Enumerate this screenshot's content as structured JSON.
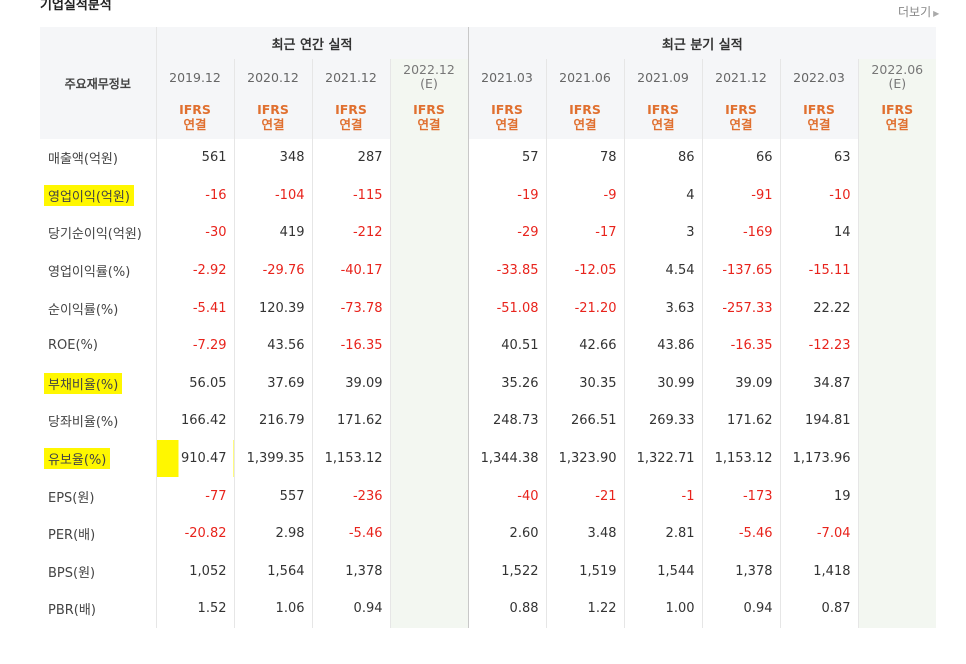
{
  "title": "기업실적분석",
  "more": "더보기",
  "row_header": "주요재무정보",
  "groups": {
    "annual": "최근 연간 실적",
    "quarterly": "최근 분기 실적"
  },
  "periods": [
    {
      "label": "2019.12",
      "sub": ""
    },
    {
      "label": "2020.12",
      "sub": ""
    },
    {
      "label": "2021.12",
      "sub": ""
    },
    {
      "label": "2022.12",
      "sub": "(E)"
    },
    {
      "label": "2021.03",
      "sub": ""
    },
    {
      "label": "2021.06",
      "sub": ""
    },
    {
      "label": "2021.09",
      "sub": ""
    },
    {
      "label": "2021.12",
      "sub": ""
    },
    {
      "label": "2022.03",
      "sub": ""
    },
    {
      "label": "2022.06",
      "sub": "(E)"
    }
  ],
  "ifrs": {
    "top": "IFRS",
    "bottom": "연결"
  },
  "rows": [
    {
      "label": "매출액(억원)",
      "highlight": false,
      "values": [
        "561",
        "348",
        "287",
        "",
        "57",
        "78",
        "86",
        "66",
        "63",
        ""
      ]
    },
    {
      "label": "영업이익(억원)",
      "highlight": true,
      "values": [
        "-16",
        "-104",
        "-115",
        "",
        "-19",
        "-9",
        "4",
        "-91",
        "-10",
        ""
      ]
    },
    {
      "label": "당기순이익(억원)",
      "highlight": false,
      "values": [
        "-30",
        "419",
        "-212",
        "",
        "-29",
        "-17",
        "3",
        "-169",
        "14",
        ""
      ]
    },
    {
      "label": "영업이익률(%)",
      "highlight": false,
      "values": [
        "-2.92",
        "-29.76",
        "-40.17",
        "",
        "-33.85",
        "-12.05",
        "4.54",
        "-137.65",
        "-15.11",
        ""
      ]
    },
    {
      "label": "순이익률(%)",
      "highlight": false,
      "values": [
        "-5.41",
        "120.39",
        "-73.78",
        "",
        "-51.08",
        "-21.20",
        "3.63",
        "-257.33",
        "22.22",
        ""
      ]
    },
    {
      "label": "ROE(%)",
      "highlight": false,
      "values": [
        "-7.29",
        "43.56",
        "-16.35",
        "",
        "40.51",
        "42.66",
        "43.86",
        "-16.35",
        "-12.23",
        ""
      ]
    },
    {
      "label": "부채비율(%)",
      "highlight": true,
      "values": [
        "56.05",
        "37.69",
        "39.09",
        "",
        "35.26",
        "30.35",
        "30.99",
        "39.09",
        "34.87",
        ""
      ]
    },
    {
      "label": "당좌비율(%)",
      "highlight": false,
      "values": [
        "166.42",
        "216.79",
        "171.62",
        "",
        "248.73",
        "266.51",
        "269.33",
        "171.62",
        "194.81",
        ""
      ]
    },
    {
      "label": "유보율(%)",
      "highlight": true,
      "values": [
        "910.47",
        "1,399.35",
        "1,153.12",
        "",
        "1,344.38",
        "1,323.90",
        "1,322.71",
        "1,153.12",
        "1,173.96",
        ""
      ]
    },
    {
      "label": "EPS(원)",
      "highlight": false,
      "values": [
        "-77",
        "557",
        "-236",
        "",
        "-40",
        "-21",
        "-1",
        "-173",
        "19",
        ""
      ]
    },
    {
      "label": "PER(배)",
      "highlight": false,
      "values": [
        "-20.82",
        "2.98",
        "-5.46",
        "",
        "2.60",
        "3.48",
        "2.81",
        "-5.46",
        "-7.04",
        ""
      ]
    },
    {
      "label": "BPS(원)",
      "highlight": false,
      "values": [
        "1,052",
        "1,564",
        "1,378",
        "",
        "1,522",
        "1,519",
        "1,544",
        "1,378",
        "1,418",
        ""
      ]
    },
    {
      "label": "PBR(배)",
      "highlight": false,
      "values": [
        "1.52",
        "1.06",
        "0.94",
        "",
        "0.88",
        "1.22",
        "1.00",
        "0.94",
        "0.87",
        ""
      ]
    }
  ],
  "colors": {
    "negative": "#e8231c",
    "ifrs": "#e07030",
    "highlight": "#fff700",
    "estimate_bg": "#f3f7f1"
  }
}
